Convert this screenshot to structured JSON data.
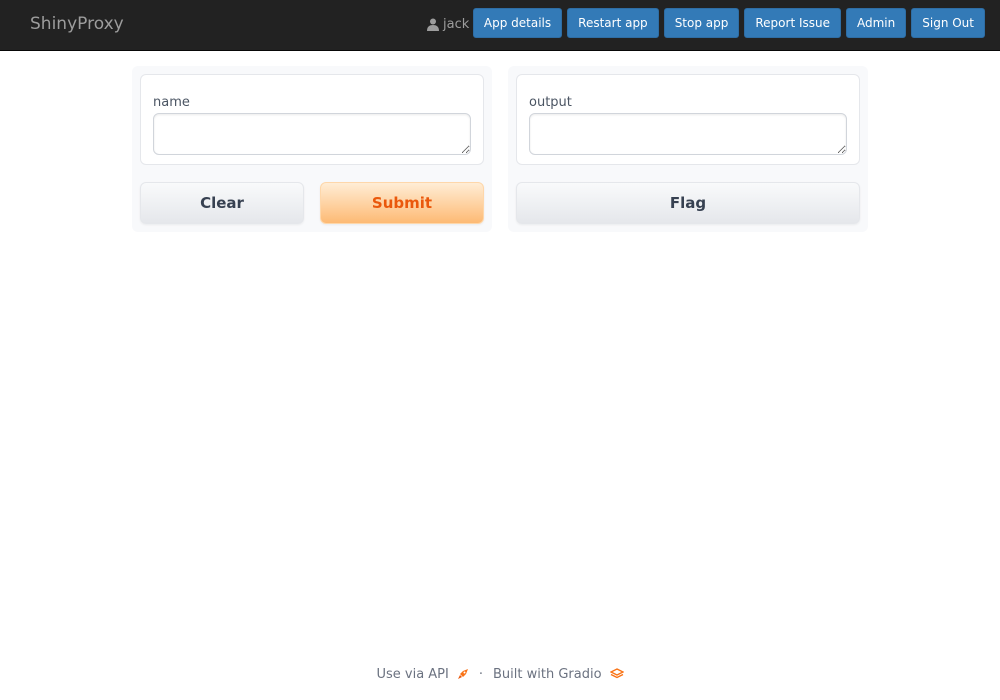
{
  "navbar": {
    "brand": "ShinyProxy",
    "user": "jack",
    "buttons": [
      "App details",
      "Restart app",
      "Stop app",
      "Report Issue",
      "Admin",
      "Sign Out"
    ]
  },
  "inputs": {
    "label": "name",
    "value": ""
  },
  "outputs": {
    "label": "output",
    "value": ""
  },
  "actions": {
    "clear": "Clear",
    "submit": "Submit",
    "flag": "Flag"
  },
  "footer": {
    "api": "Use via API",
    "separator": "·",
    "built": "Built with Gradio"
  },
  "colors": {
    "navbar_bg": "#222222",
    "nav_button": "#337ab7",
    "primary_text": "#ea580c"
  },
  "icons": {
    "user": "user-icon",
    "api": "rocket-icon",
    "gradio": "gradio-logo-icon"
  }
}
